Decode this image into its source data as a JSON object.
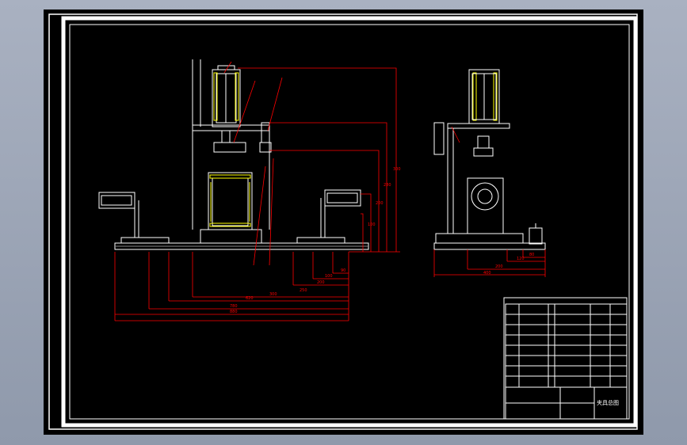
{
  "drawing": {
    "title_block_title": "夹具总图",
    "front_view_dims": [
      "300",
      "280",
      "200",
      "100",
      "160",
      "60",
      "290"
    ],
    "front_view_bottom_dims": [
      "90",
      "100",
      "200",
      "250",
      "300",
      "620",
      "780",
      "880"
    ],
    "side_view_dims": [
      "80",
      "120",
      "200",
      "400"
    ],
    "colors": {
      "background": "#000000",
      "outline": "#ffffff",
      "dimension": "#ff0000",
      "hatch": "#ffff00",
      "screen": "#98a2b3"
    }
  }
}
